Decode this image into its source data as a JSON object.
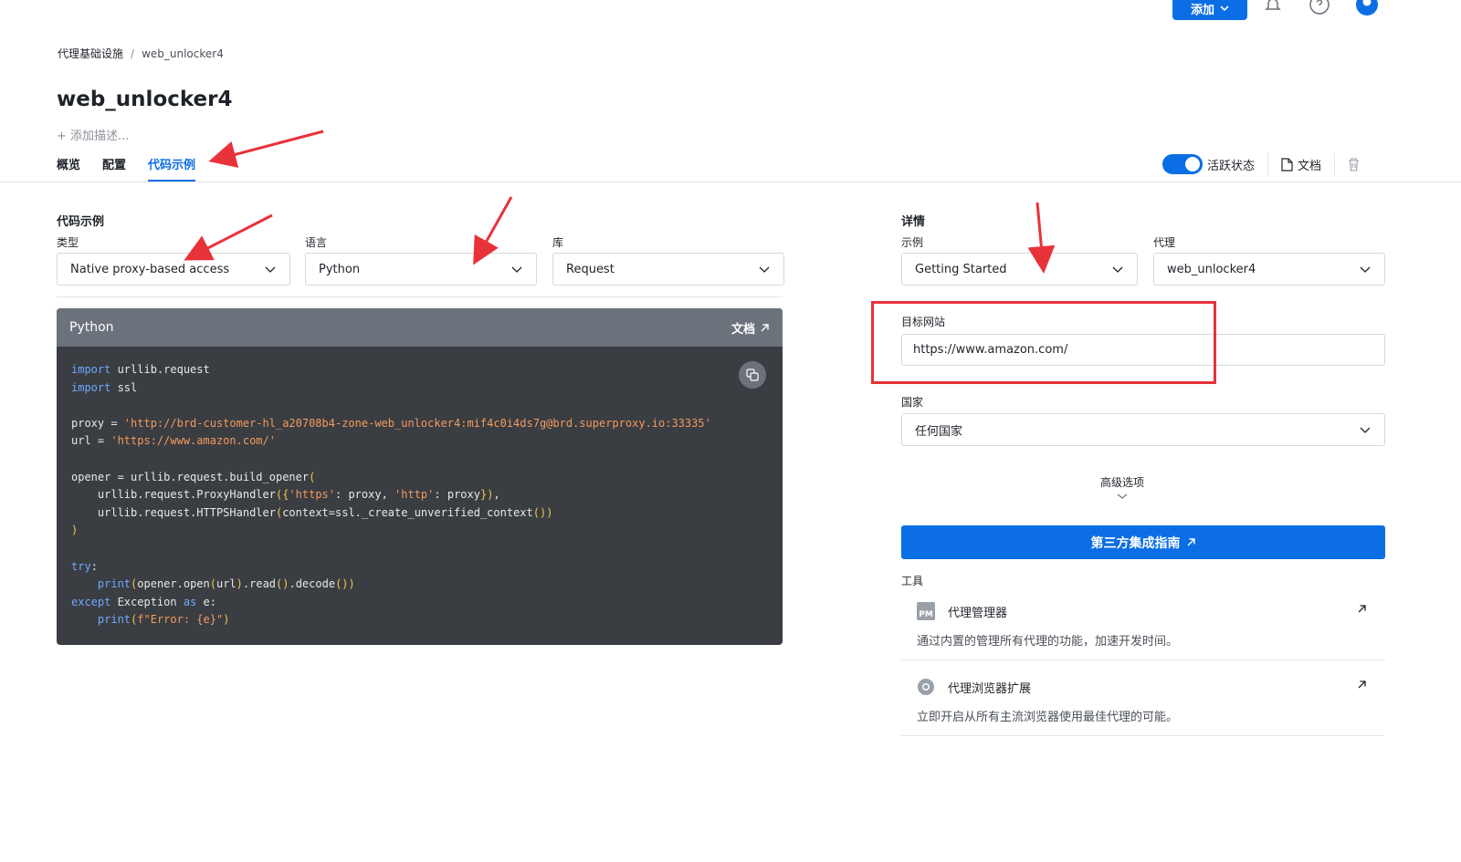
{
  "header": {
    "add_label": "添加",
    "breadcrumb": {
      "root": "代理基础设施",
      "separator": "/",
      "current": "web_unlocker4"
    },
    "title": "web_unlocker4",
    "add_description": "+ 添加描述..."
  },
  "tabs": [
    {
      "label": "概览",
      "active": false
    },
    {
      "label": "配置",
      "active": false
    },
    {
      "label": "代码示例",
      "active": true
    }
  ],
  "toolbar": {
    "active_label": "活跃状态",
    "active_on": true,
    "docs_label": "文档"
  },
  "code_examples": {
    "section_title": "代码示例",
    "type": {
      "label": "类型",
      "value": "Native proxy-based access"
    },
    "language": {
      "label": "语言",
      "value": "Python"
    },
    "library": {
      "label": "库",
      "value": "Request"
    },
    "card": {
      "title": "Python",
      "docs_label": "文档",
      "lines": {
        "l1_kw": "import",
        "l1_rest": " urllib.request",
        "l2_kw": "import",
        "l2_rest": " ssl",
        "l4_pre": "proxy = ",
        "l4_str": "'http://brd-customer-hl_a20708b4-zone-web_unlocker4:mif4c0i4ds7g@brd.superproxy.io:33335'",
        "l5_pre": "url = ",
        "l5_str": "'https://www.amazon.com/'",
        "l7_pre": "opener = urllib.request.build_opener",
        "l7_paren": "(",
        "l8_pre": "    urllib.request.ProxyHandler",
        "l8_p1": "({",
        "l8_s1": "'https'",
        "l8_m1": ": proxy, ",
        "l8_s2": "'http'",
        "l8_m2": ": proxy",
        "l8_p2": "})",
        "l8_end": ",",
        "l9_pre": "    urllib.request.HTTPSHandler",
        "l9_p1": "(",
        "l9_mid": "context=ssl._create_unverified_context",
        "l9_p2": "())",
        "l10_paren": ")",
        "l12_kw": "try",
        "l12_rest": ":",
        "l13_ind": "    ",
        "l13_kw": "print",
        "l13_p1": "(",
        "l13_a": "opener.open",
        "l13_p2": "(",
        "l13_b": "url",
        "l13_p3": ")",
        "l13_c": ".read",
        "l13_p4": "()",
        "l13_d": ".decode",
        "l13_p5": "())",
        "l14_kw": "except",
        "l14_mid": " Exception ",
        "l14_kw2": "as",
        "l14_rest": " e:",
        "l15_ind": "    ",
        "l15_kw": "print",
        "l15_p1": "(",
        "l15_str": "f\"Error: {e}\"",
        "l15_p2": ")"
      }
    }
  },
  "details": {
    "section_title": "详情",
    "example": {
      "label": "示例",
      "value": "Getting Started"
    },
    "proxy": {
      "label": "代理",
      "value": "web_unlocker4"
    },
    "target": {
      "label": "目标网站",
      "value": "https://www.amazon.com/"
    },
    "country": {
      "label": "国家",
      "value": "任何国家"
    },
    "advanced_label": "高级选项",
    "cta_label": "第三方集成指南",
    "tools_label": "工具",
    "tools": [
      {
        "icon": "PM",
        "title": "代理管理器",
        "desc": "通过内置的管理所有代理的功能，加速开发时间。"
      },
      {
        "title": "代理浏览器扩展",
        "desc": "立即开启从所有主流浏览器使用最佳代理的可能。"
      }
    ]
  },
  "colors": {
    "accent": "#0b6ee5",
    "annotation": "#e8323a",
    "code_bg": "#3a3d42",
    "code_header": "#6c727b"
  }
}
